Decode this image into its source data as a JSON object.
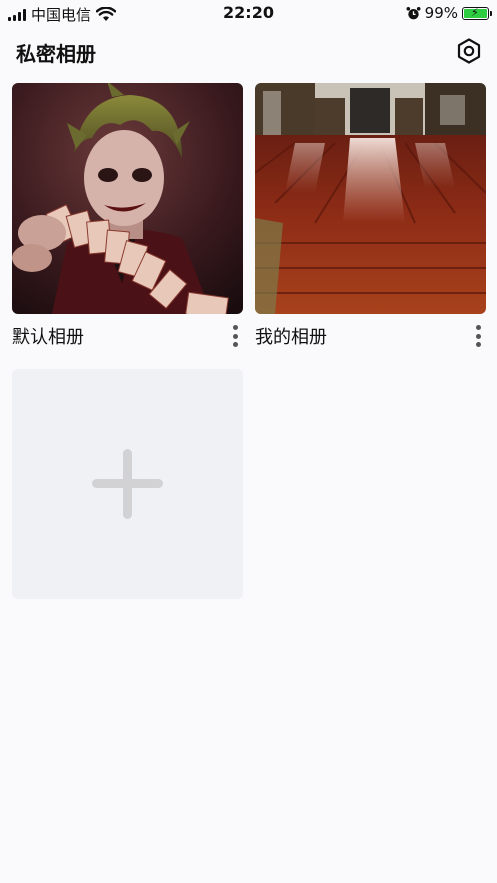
{
  "status_bar": {
    "carrier": "中国电信",
    "time": "22:20",
    "battery_percent": "99%",
    "battery_level": 0.99,
    "icons": [
      "signal-icon",
      "wifi-icon",
      "alarm-icon",
      "battery-icon"
    ]
  },
  "header": {
    "title": "私密相册",
    "settings_icon": "hexagon-settings-icon"
  },
  "albums": [
    {
      "name": "默认相册",
      "thumbnail": "joker-portrait-photo",
      "menu_icon": "more-vertical-icon"
    },
    {
      "name": "我的相册",
      "thumbnail": "wooden-floor-room-photo",
      "menu_icon": "more-vertical-icon"
    }
  ],
  "add_album": {
    "icon": "plus-icon"
  },
  "colors": {
    "background": "#fafafc",
    "add_card_bg": "#f0f1f4",
    "plus_color": "#d2d2d4",
    "battery_fill": "#2ecc40"
  }
}
